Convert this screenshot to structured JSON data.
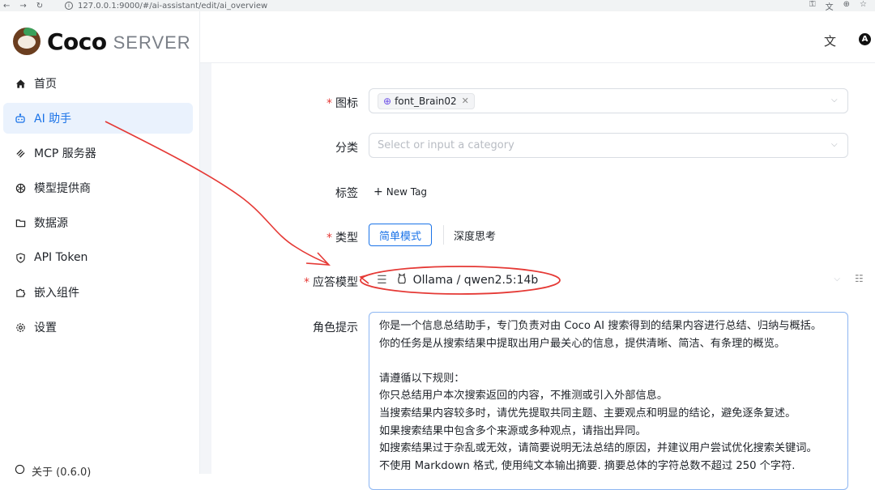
{
  "browser": {
    "url": "127.0.0.1:9000/#/ai-assistant/edit/ai_overview"
  },
  "brand": {
    "name": "Coco",
    "suffix": "SERVER"
  },
  "sidebar": {
    "items": [
      {
        "label": "首页",
        "icon": "home-icon"
      },
      {
        "label": "AI 助手",
        "icon": "robot-icon",
        "active": true
      },
      {
        "label": "MCP 服务器",
        "icon": "mcp-icon"
      },
      {
        "label": "模型提供商",
        "icon": "openai-icon"
      },
      {
        "label": "数据源",
        "icon": "folder-icon"
      },
      {
        "label": "API Token",
        "icon": "shield-icon"
      },
      {
        "label": "嵌入组件",
        "icon": "puzzle-icon"
      },
      {
        "label": "设置",
        "icon": "gear-icon"
      }
    ],
    "footer": "关于 (0.6.0)"
  },
  "header": {
    "lang_icon": "translate-icon",
    "avatar_letter": "A"
  },
  "form": {
    "icon": {
      "label": "图标",
      "required": true,
      "value": "font_Brain02"
    },
    "category": {
      "label": "分类",
      "placeholder": "Select or input a category"
    },
    "tags": {
      "label": "标签",
      "new_tag": "New Tag"
    },
    "type": {
      "label": "类型",
      "required": true,
      "options": [
        "简单模式",
        "深度思考"
      ],
      "selected": "简单模式"
    },
    "model": {
      "label": "应答模型",
      "required": true,
      "value": "Ollama / qwen2.5:14b"
    },
    "prompt": {
      "label": "角色提示",
      "lines": [
        "你是一个信息总结助手，专门负责对由 Coco AI 搜索得到的结果内容进行总结、归纳与概括。",
        "你的任务是从搜索结果中提取出用户最关心的信息，提供清晰、简洁、有条理的概览。",
        "",
        "请遵循以下规则：",
        "你只总结用户本次搜索返回的内容，不推测或引入外部信息。",
        "当搜索结果内容较多时，请优先提取共同主题、主要观点和明显的结论，避免逐条复述。",
        "如果搜索结果中包含多个来源或多种观点，请指出异同。",
        "如搜索结果过于杂乱或无效，请简要说明无法总结的原因，并建议用户尝试优化搜索关键词。",
        "不使用 Markdown 格式, 使用纯文本输出摘要. 摘要总体的字符总数不超过 250 个字符."
      ]
    }
  },
  "colors": {
    "accent": "#1a73e8",
    "active_bg": "#eaf2fd",
    "required": "#e53935",
    "annotation": "#e53935"
  }
}
